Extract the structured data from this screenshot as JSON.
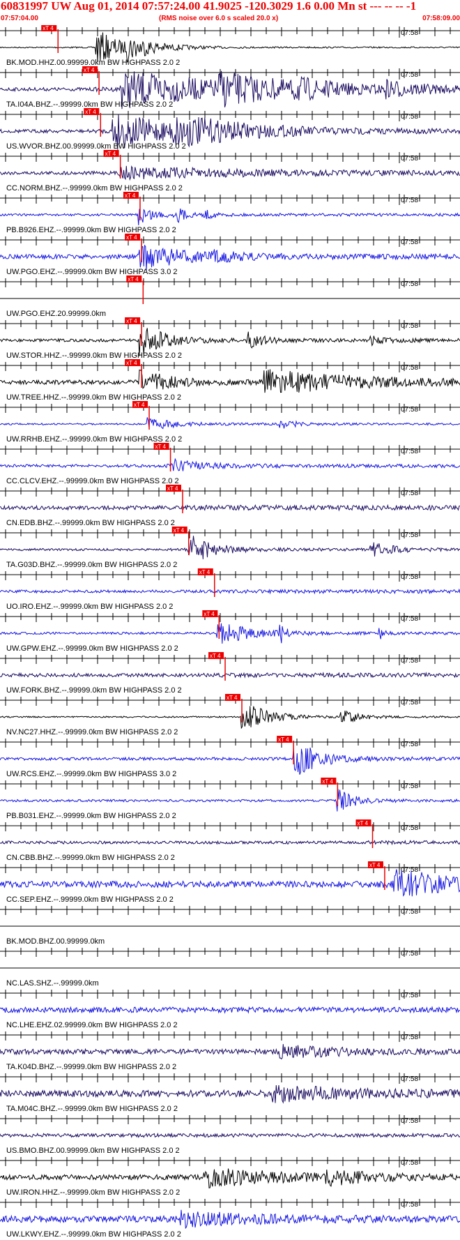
{
  "header": {
    "title": "60831997 UW Aug 01, 2014 07:57:24.00   41.9025 -120.3029  1.6 0.00 Mn st --- -- --   -1",
    "start_time": "07:57:04.00",
    "end_time": "07:58:09.00",
    "subtitle": "(RMS noise over 6.0 s scaled 20.0 x)"
  },
  "colors": {
    "header": "#ee0000",
    "pick": "#ee0000",
    "black": "#000000",
    "navy": "#1a0a5e",
    "blue": "#1414e0",
    "axis": "#000000"
  },
  "chart_data": {
    "type": "line",
    "title": "60831997 UW Aug 01, 2014 07:57:24.00   41.9025 -120.3029  1.6 0.00 Mn st --- -- --   -1",
    "subtitle": "(RMS noise over 6.0 s scaled 20.0 x)",
    "xlabel": "",
    "ylabel": "",
    "time_axis": {
      "start": "07:57:04.00",
      "end": "07:58:09.00",
      "duration_s": 65,
      "minute_mark": "07:58"
    },
    "pick_label": "xT 4",
    "traces": [
      {
        "label": "BK.MOD.HHZ.00.99999.0km BW  HIGHPASS  2.0  2",
        "color": "black",
        "pick_s": 1.8,
        "events": [
          [
            4.4,
            1.0,
            1.5
          ],
          [
            6.5,
            0.5,
            2
          ]
        ],
        "noise": 0.04
      },
      {
        "label": "TA.I04A.BHZ.--.99999.0km BW  HIGHPASS  2.0  2",
        "color": "navy",
        "pick_s": 4.5,
        "events": [
          [
            6.0,
            1.0,
            7
          ],
          [
            12.5,
            0.6,
            4
          ],
          [
            17.5,
            0.3,
            2
          ],
          [
            23.5,
            0.35,
            2
          ]
        ],
        "noise": 0.12
      },
      {
        "label": "US.WVOR.BHZ.00.99999.0km BW  HIGHPASS  2.0  2",
        "color": "navy",
        "pick_s": 4.6,
        "events": [
          [
            5.5,
            1.0,
            4
          ],
          [
            9.5,
            0.6,
            5
          ]
        ],
        "noise": 0.12
      },
      {
        "label": "CC.NORM.BHZ.--.99999.0km BW  HIGHPASS  2.0  2",
        "color": "navy",
        "pick_s": 5.9,
        "events": [
          [
            6.0,
            0.3,
            8
          ]
        ],
        "noise": 0.12
      },
      {
        "label": "PB.B926.EHZ.--.99999.0km BW  HIGHPASS  2.0  2",
        "color": "blue",
        "pick_s": 7.2,
        "events": [
          [
            7.2,
            0.5,
            1.0
          ],
          [
            9.8,
            0.3,
            0.5
          ],
          [
            11.5,
            0.25,
            0.5
          ]
        ],
        "noise": 0.08
      },
      {
        "label": "UW.PGO.EHZ.--.99999.0km BW  HIGHPASS  3.0  2",
        "color": "blue",
        "pick_s": 7.3,
        "events": [
          [
            7.3,
            0.7,
            2.5
          ],
          [
            12.0,
            0.2,
            1.5
          ]
        ],
        "noise": 0.15
      },
      {
        "label": "UW.PGO.EHZ.20.99999.0km",
        "color": "black",
        "pick_s": 7.4,
        "events": [],
        "noise": 0
      },
      {
        "label": "UW.STOR.HHZ.--.99999.0km BW  HIGHPASS  2.0  2",
        "color": "black",
        "pick_s": 7.3,
        "events": [
          [
            7.3,
            0.9,
            1.5
          ],
          [
            14.3,
            0.4,
            1
          ],
          [
            22.5,
            0.2,
            1
          ]
        ],
        "noise": 0.1
      },
      {
        "label": "UW.TREE.HHZ.--.99999.0km BW  HIGHPASS  2.0  2",
        "color": "black",
        "pick_s": 7.3,
        "events": [
          [
            7.3,
            0.7,
            1.5
          ],
          [
            15.5,
            0.6,
            6
          ]
        ],
        "noise": 0.15
      },
      {
        "label": "UW.RRHB.EHZ.--.99999.0km BW  HIGHPASS  2.0  2",
        "color": "blue",
        "pick_s": 7.8,
        "events": [
          [
            7.8,
            0.35,
            1.5
          ],
          [
            16.5,
            0.25,
            1
          ]
        ],
        "noise": 0.06
      },
      {
        "label": "CC.CLCV.EHZ.--.99999.0km BW  HIGHPASS  2.0  2",
        "color": "blue",
        "pick_s": 9.2,
        "events": [
          [
            9.4,
            0.3,
            2
          ]
        ],
        "noise": 0.1
      },
      {
        "label": "CN.EDB.BHZ.--.99999.0km BW  HIGHPASS  2.0  2",
        "color": "navy",
        "pick_s": 10.0,
        "events": [],
        "noise": 0.14
      },
      {
        "label": "TA.G03D.BHZ.--.99999.0km BW  HIGHPASS  2.0  2",
        "color": "navy",
        "pick_s": 10.4,
        "events": [
          [
            10.5,
            0.8,
            1.5
          ],
          [
            22.5,
            0.35,
            1.5
          ]
        ],
        "noise": 0.08
      },
      {
        "label": "UO.IRO.EHZ.--.99999.0km BW  HIGHPASS  2.0  2",
        "color": "blue",
        "pick_s": 12.1,
        "events": [],
        "noise": 0.1
      },
      {
        "label": "UW.GPW.EHZ.--.99999.0km BW  HIGHPASS  2.0  2",
        "color": "blue",
        "pick_s": 12.4,
        "events": [
          [
            12.4,
            0.6,
            2
          ],
          [
            1.7,
            0.5,
            0.3
          ],
          [
            3.8,
            0.6,
            0.3
          ],
          [
            16.5,
            0.4,
            0.3
          ],
          [
            23.0,
            0.3,
            0.3
          ]
        ],
        "noise": 0.08
      },
      {
        "label": "UW.FORK.BHZ.--.99999.0km BW  HIGHPASS  2.0  2",
        "color": "navy",
        "pick_s": 12.8,
        "events": [],
        "noise": 0.12
      },
      {
        "label": "NV.NC27.HHZ.--.99999.0km BW  HIGHPASS  2.0  2",
        "color": "black",
        "pick_s": 13.9,
        "events": [
          [
            7.5,
            0.35,
            1
          ],
          [
            14.0,
            0.9,
            1.5
          ],
          [
            20.5,
            0.45,
            1
          ]
        ],
        "noise": 0.05
      },
      {
        "label": "UW.RCS.EHZ.--.99999.0km BW  HIGHPASS  3.0  2",
        "color": "blue",
        "pick_s": 17.3,
        "events": [
          [
            17.4,
            1.0,
            1.5
          ]
        ],
        "noise": 0.1
      },
      {
        "label": "PB.B031.EHZ.--.99999.0km BW  HIGHPASS  2.0  2",
        "color": "blue",
        "pick_s": 20.2,
        "events": [
          [
            2.3,
            0.7,
            1.5
          ],
          [
            5.0,
            0.6,
            2
          ],
          [
            12.2,
            0.5,
            0.5
          ],
          [
            20.3,
            0.6,
            1
          ]
        ],
        "noise": 0.08
      },
      {
        "label": "CN.CBB.BHZ.--.99999.0km BW  HIGHPASS  2.0  2",
        "color": "navy",
        "pick_s": 22.5,
        "events": [],
        "noise": 0.1
      },
      {
        "label": "CC.SEP.EHZ.--.99999.0km BW  HIGHPASS  2.0  2",
        "color": "blue",
        "pick_s": 23.3,
        "events": [
          [
            24.0,
            0.8,
            3
          ]
        ],
        "noise": 0.22
      },
      {
        "label": "BK.MOD.BHZ.00.99999.0km",
        "color": "black",
        "pick_s": null,
        "events": [],
        "noise": 0
      },
      {
        "label": "NC.LAS.SHZ.--.99999.0km",
        "color": "black",
        "pick_s": null,
        "events": [],
        "noise": 0
      },
      {
        "label": "NC.LHE.EHZ.02.99999.0km BW  HIGHPASS  2.0  2",
        "color": "blue",
        "pick_s": null,
        "events": [],
        "noise": 0.15
      },
      {
        "label": "TA.K04D.BHZ.--.99999.0km BW  HIGHPASS  2.0  2",
        "color": "navy",
        "pick_s": null,
        "events": [
          [
            16.5,
            0.3,
            4
          ]
        ],
        "noise": 0.14
      },
      {
        "label": "TA.M04C.BHZ.--.99999.0km BW  HIGHPASS  2.0  2",
        "color": "navy",
        "pick_s": null,
        "events": [
          [
            16.0,
            0.35,
            6
          ]
        ],
        "noise": 0.18
      },
      {
        "label": "US.BMO.BHZ.00.99999.0km BW  HIGHPASS  2.0  2",
        "color": "navy",
        "pick_s": null,
        "events": [],
        "noise": 0.1
      },
      {
        "label": "UW.IRON.HHZ.--.99999.0km BW  HIGHPASS  2.0  2",
        "color": "black",
        "pick_s": null,
        "events": [
          [
            11.5,
            0.5,
            5
          ],
          [
            19.5,
            0.3,
            3
          ]
        ],
        "noise": 0.14
      },
      {
        "label": "UW.LKWY.EHZ.--.99999.0km BW  HIGHPASS  2.0  2",
        "color": "blue",
        "pick_s": null,
        "events": [
          [
            10.0,
            0.35,
            5
          ]
        ],
        "noise": 0.18
      }
    ]
  }
}
